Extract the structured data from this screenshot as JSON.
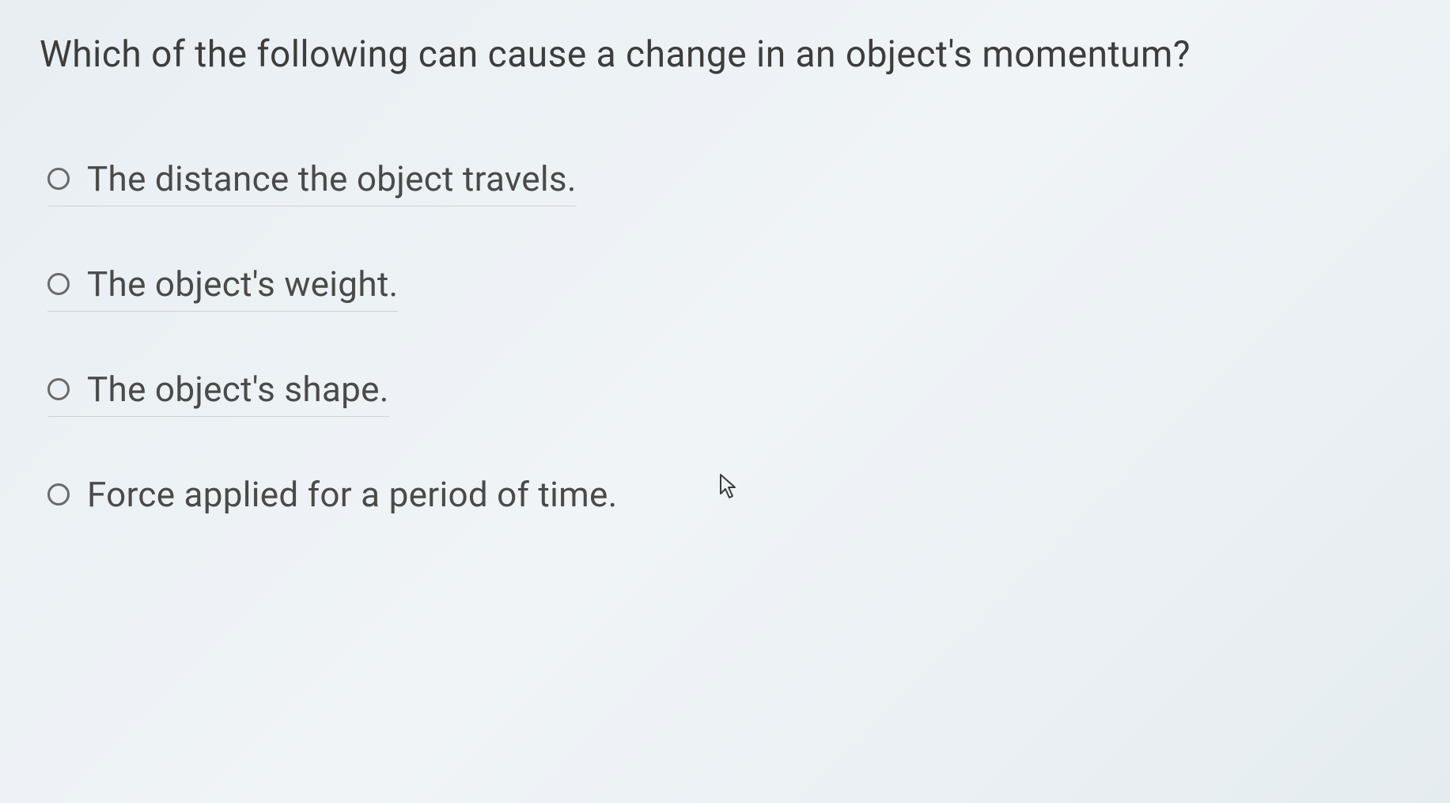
{
  "question": {
    "text": "Which of the following can cause a change in an object's momentum?"
  },
  "options": [
    {
      "label": "The distance the object travels."
    },
    {
      "label": "The object's weight."
    },
    {
      "label": "The object's shape."
    },
    {
      "label": "Force applied for a period of time."
    }
  ]
}
